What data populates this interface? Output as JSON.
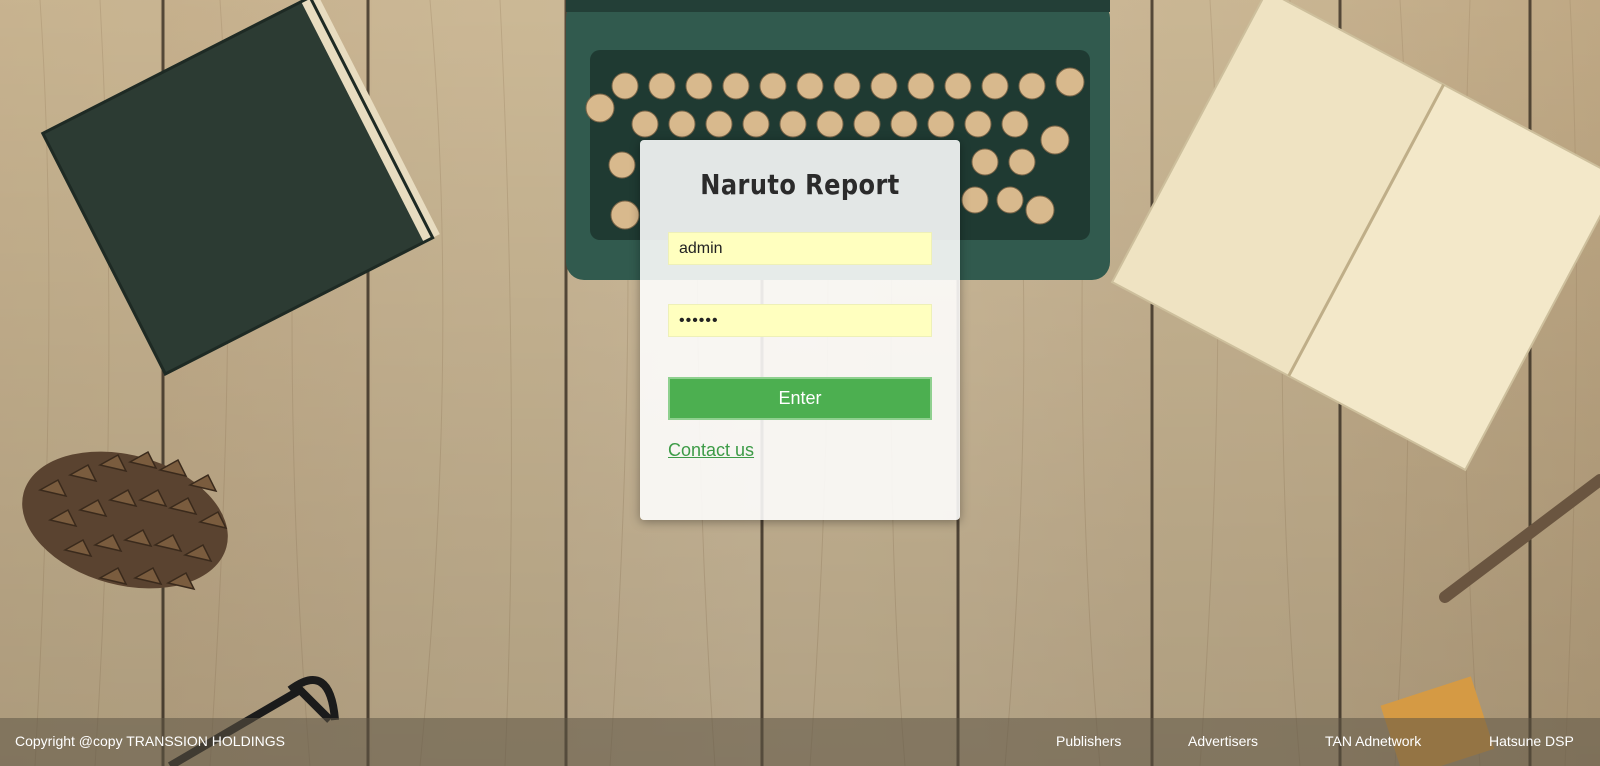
{
  "login": {
    "title": "Naruto Report",
    "username_value": "admin",
    "password_value": "••••••",
    "enter_label": "Enter",
    "contact_label": "Contact us"
  },
  "footer": {
    "copyright": "Copyright @copy TRANSSION HOLDINGS",
    "links": [
      "Publishers",
      "Advertisers",
      "TAN Adnetwork",
      "Hatsune DSP"
    ]
  },
  "colors": {
    "button_green": "#4caf50",
    "input_yellow": "#ffffbf",
    "link_green": "#3d9b47"
  }
}
